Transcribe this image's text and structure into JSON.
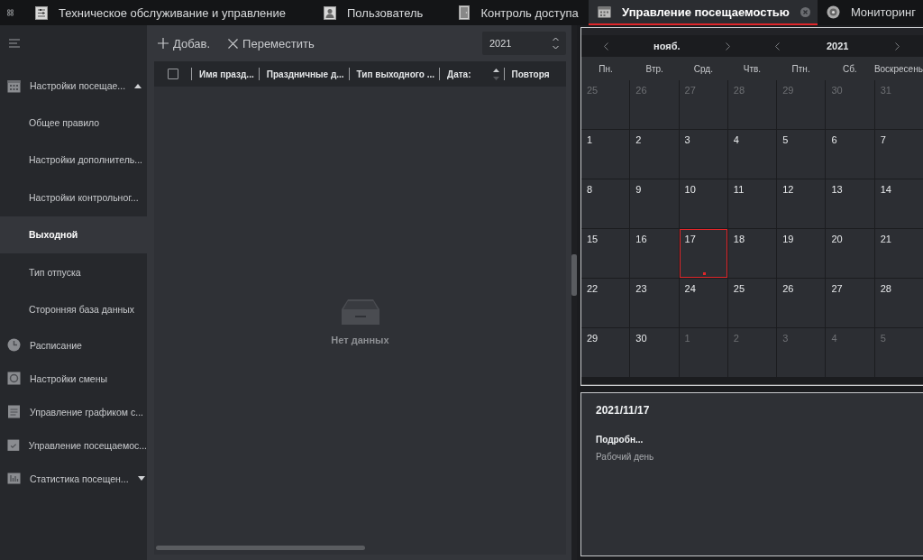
{
  "top_nav": [
    {
      "label": "Техническое обслуживание и управление"
    },
    {
      "label": "Пользователь"
    },
    {
      "label": "Контроль доступа"
    }
  ],
  "tabs": [
    {
      "label": "Управление посещаемостью",
      "selected": true,
      "closable": true
    },
    {
      "label": "Мониторинг",
      "selected": false,
      "closable": false
    }
  ],
  "sidebar": {
    "items": [
      {
        "label": "Настройки посещае...",
        "kind": "group",
        "expanded": true,
        "children": [
          {
            "label": "Общее правило",
            "selected": false
          },
          {
            "label": "Настройки дополнитель...",
            "selected": false
          },
          {
            "label": "Настройки контрольног...",
            "selected": false
          },
          {
            "label": "Выходной",
            "selected": true
          },
          {
            "label": "Тип отпуска",
            "selected": false
          },
          {
            "label": "Сторонняя база данных",
            "selected": false
          }
        ]
      },
      {
        "label": "Расписание",
        "kind": "link"
      },
      {
        "label": "Настройки смены",
        "kind": "link"
      },
      {
        "label": "Управление графиком с...",
        "kind": "link"
      },
      {
        "label": "Управление посещаемос...",
        "kind": "link"
      },
      {
        "label": "Статистика посещен...",
        "kind": "group",
        "expanded": false
      }
    ]
  },
  "toolbar": {
    "buttons": [
      {
        "label": "Добав.",
        "kind": "add"
      },
      {
        "label": "Переместить",
        "kind": "remove"
      }
    ],
    "year_field": {
      "value": "2021"
    }
  },
  "table": {
    "select_all": {
      "checked": false
    },
    "columns": [
      {
        "label": "Имя празд...",
        "sortable": false
      },
      {
        "label": "Праздничные д...",
        "sortable": false
      },
      {
        "label": "Тип выходного ...",
        "sortable": false
      },
      {
        "label": "Дата:",
        "sortable": true
      },
      {
        "label": "Повторя",
        "sortable": false
      }
    ],
    "empty_text": "Нет данных"
  },
  "calendar": {
    "month": "нояб.",
    "year": "2021",
    "weekdays": [
      "Пн.",
      "Втр.",
      "Срд.",
      "Чтв.",
      "Птн.",
      "Сб.",
      "Воскресень"
    ],
    "days": [
      {
        "day": "25",
        "in_month": false,
        "selected": false
      },
      {
        "day": "26",
        "in_month": false,
        "selected": false
      },
      {
        "day": "27",
        "in_month": false,
        "selected": false
      },
      {
        "day": "28",
        "in_month": false,
        "selected": false
      },
      {
        "day": "29",
        "in_month": false,
        "selected": false
      },
      {
        "day": "30",
        "in_month": false,
        "selected": false
      },
      {
        "day": "31",
        "in_month": false,
        "selected": false
      },
      {
        "day": "1",
        "in_month": true,
        "selected": false
      },
      {
        "day": "2",
        "in_month": true,
        "selected": false
      },
      {
        "day": "3",
        "in_month": true,
        "selected": false
      },
      {
        "day": "4",
        "in_month": true,
        "selected": false
      },
      {
        "day": "5",
        "in_month": true,
        "selected": false
      },
      {
        "day": "6",
        "in_month": true,
        "selected": false
      },
      {
        "day": "7",
        "in_month": true,
        "selected": false
      },
      {
        "day": "8",
        "in_month": true,
        "selected": false
      },
      {
        "day": "9",
        "in_month": true,
        "selected": false
      },
      {
        "day": "10",
        "in_month": true,
        "selected": false
      },
      {
        "day": "11",
        "in_month": true,
        "selected": false
      },
      {
        "day": "12",
        "in_month": true,
        "selected": false
      },
      {
        "day": "13",
        "in_month": true,
        "selected": false
      },
      {
        "day": "14",
        "in_month": true,
        "selected": false
      },
      {
        "day": "15",
        "in_month": true,
        "selected": false
      },
      {
        "day": "16",
        "in_month": true,
        "selected": false
      },
      {
        "day": "17",
        "in_month": true,
        "selected": true
      },
      {
        "day": "18",
        "in_month": true,
        "selected": false
      },
      {
        "day": "19",
        "in_month": true,
        "selected": false
      },
      {
        "day": "20",
        "in_month": true,
        "selected": false
      },
      {
        "day": "21",
        "in_month": true,
        "selected": false
      },
      {
        "day": "22",
        "in_month": true,
        "selected": false
      },
      {
        "day": "23",
        "in_month": true,
        "selected": false
      },
      {
        "day": "24",
        "in_month": true,
        "selected": false
      },
      {
        "day": "25",
        "in_month": true,
        "selected": false
      },
      {
        "day": "26",
        "in_month": true,
        "selected": false
      },
      {
        "day": "27",
        "in_month": true,
        "selected": false
      },
      {
        "day": "28",
        "in_month": true,
        "selected": false
      },
      {
        "day": "29",
        "in_month": true,
        "selected": false
      },
      {
        "day": "30",
        "in_month": true,
        "selected": false
      },
      {
        "day": "1",
        "in_month": false,
        "selected": false
      },
      {
        "day": "2",
        "in_month": false,
        "selected": false
      },
      {
        "day": "3",
        "in_month": false,
        "selected": false
      },
      {
        "day": "4",
        "in_month": false,
        "selected": false
      },
      {
        "day": "5",
        "in_month": false,
        "selected": false
      }
    ]
  },
  "details": {
    "date": "2021/11/17",
    "heading": "Подробн...",
    "text": "Рабочий день"
  }
}
